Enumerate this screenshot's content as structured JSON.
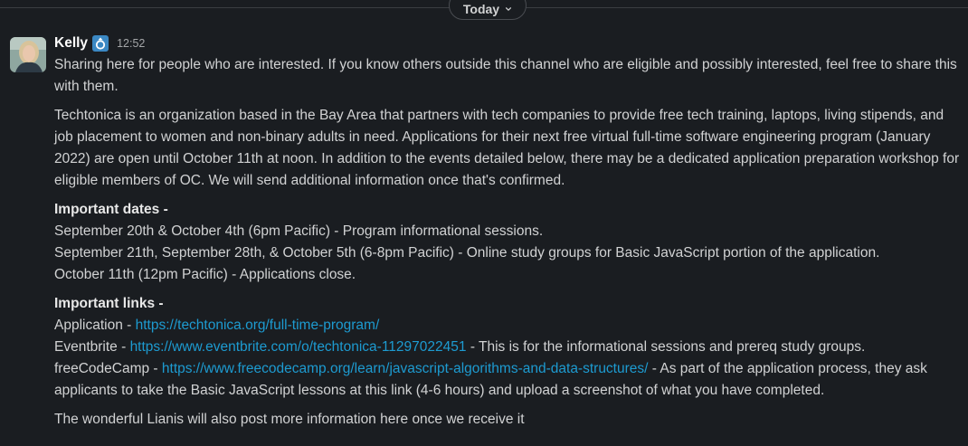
{
  "day_divider": {
    "label": "Today"
  },
  "message": {
    "author": "Kelly",
    "status_icon": "ring-emoji-icon",
    "time": "12:52",
    "p1": "Sharing here for people who are interested. If you know others outside this channel who are eligible and possibly interested, feel free to share this with them.",
    "p2": "Techtonica is an organization based in the Bay Area that partners with tech companies to provide free tech training, laptops, living stipends, and job placement to women and non-binary adults in need. Applications for their next free virtual full-time software engineering program (January 2022) are open until October 11th at noon. In addition to the events detailed below, there may be a dedicated application preparation workshop for eligible members of OC. We will send additional information once that's confirmed.",
    "dates_heading": "Important dates -",
    "dates": [
      "September 20th & October 4th (6pm Pacific) - Program informational sessions.",
      "September 21th, September 28th, & October 5th (6-8pm Pacific) - Online study groups for Basic JavaScript portion of the application.",
      "October 11th (12pm Pacific) - Applications close."
    ],
    "links_heading": "Important links -",
    "links": [
      {
        "prefix": "Application - ",
        "url": "https://techtonica.org/full-time-program/",
        "suffix": ""
      },
      {
        "prefix": "Eventbrite - ",
        "url": "https://www.eventbrite.com/o/techtonica-11297022451",
        "suffix": " - This is for the informational sessions and prereq study groups."
      },
      {
        "prefix": "freeCodeCamp - ",
        "url": "https://www.freecodecamp.org/learn/javascript-algorithms-and-data-structures/",
        "suffix": " - As part of the application process, they ask applicants to take the Basic JavaScript lessons at this link (4-6 hours) and upload a screenshot of what you have completed."
      }
    ],
    "closing": "The wonderful Lianis will also post more information here once we receive it"
  },
  "colors": {
    "background": "#1a1d21",
    "text": "#d1d2d3",
    "link": "#1d9bd1",
    "name": "#ffffff"
  }
}
